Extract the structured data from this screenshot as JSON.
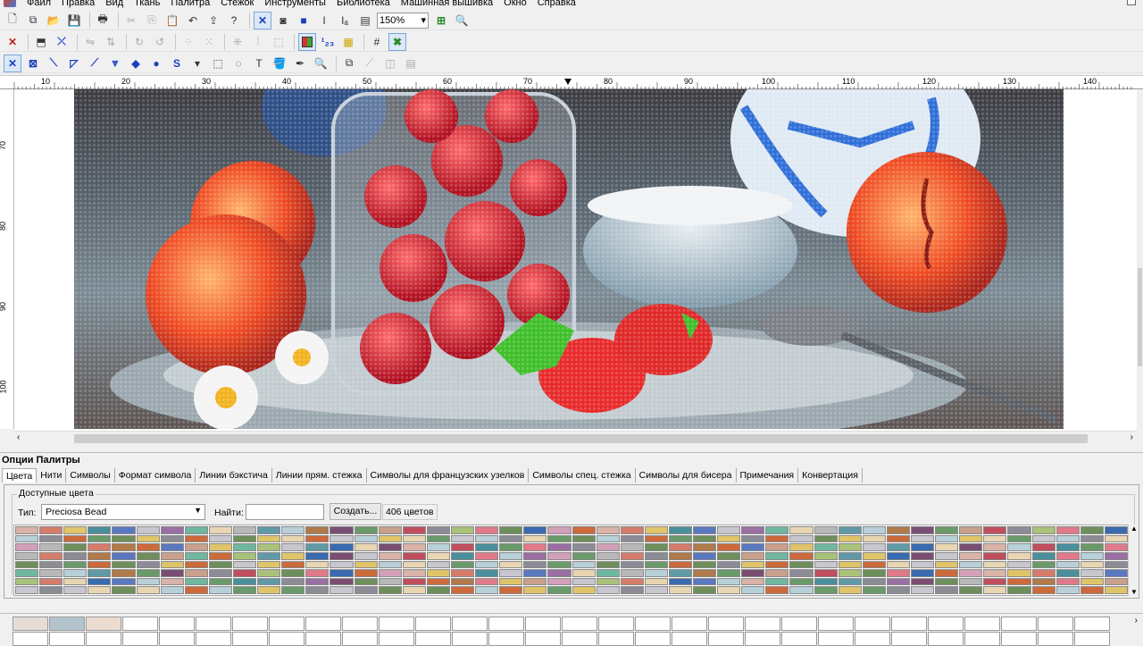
{
  "menu": [
    "Файл",
    "Правка",
    "Вид",
    "Ткань",
    "Палитра",
    "Стежок",
    "Инструменты",
    "Библиотека",
    "Машинная вышивка",
    "Окно",
    "Справка"
  ],
  "toolbar": {
    "zoom_value": "150%",
    "row1_icons": [
      "new-icon",
      "copy-doc-icon",
      "open-icon",
      "save-icon",
      "print-icon",
      "cut-icon",
      "copy-icon",
      "paste-icon",
      "undo-icon",
      "export-icon",
      "help-icon",
      "full-cross-icon",
      "fill-icon",
      "square-icon",
      "text-i-icon",
      "text-ic-icon",
      "doc-icon",
      "zoom-fit-icon",
      "zoom-select-icon"
    ],
    "row2_icons": [
      "delete-icon",
      "move-icon",
      "replace-icon",
      "mirror-h-icon",
      "mirror-v-icon",
      "rotate-cw-icon",
      "rotate-ccw-icon",
      "dots-a-icon",
      "dots-b-icon",
      "dots-c-icon",
      "dots-d-icon",
      "dots-e-icon",
      "palette-icon",
      "number-icon",
      "pattern-icon",
      "grid-icon",
      "cross-grid-icon"
    ],
    "row3_icons": [
      "cross-stitch-icon",
      "half-a-icon",
      "half-b-icon",
      "quarter-a-icon",
      "quarter-b-icon",
      "petite-icon",
      "bead-icon",
      "french-knot-icon",
      "lazy-s-icon",
      "rect-select-icon",
      "lasso-icon",
      "text-icon",
      "fill-bucket-icon",
      "eyedropper-icon",
      "magnify-icon",
      "tool-a-icon",
      "tool-b-icon",
      "tool-c-icon",
      "tool-d-icon"
    ]
  },
  "ruler": {
    "top": [
      "10",
      "20",
      "30",
      "40",
      "50",
      "60",
      "70",
      "80",
      "90",
      "100",
      "110",
      "120",
      "130",
      "140"
    ],
    "left": [
      "70",
      "80",
      "90",
      "100"
    ]
  },
  "palette": {
    "title": "Опции Палитры",
    "tabs": [
      "Цвета",
      "Нити",
      "Символы",
      "Формат символа",
      "Линии бэкстича",
      "Линии прям. стежка",
      "Символы для французских узелков",
      "Символы спец. стежка",
      "Символы для бисера",
      "Примечания",
      "Конвертация"
    ],
    "active_tab": "Цвета",
    "group_label": "Доступные цвета",
    "type_label": "Тип:",
    "type_value": "Preciosa Bead",
    "find_label": "Найти:",
    "find_value": "",
    "create_label": "Создать...",
    "count_label": "406 цветов"
  },
  "colors": {
    "swatch_base": [
      "#d9b2a8",
      "#c8c6ce",
      "#5f9aa6",
      "#c8a08b",
      "#6e8f5b",
      "#d67c6b",
      "#9a6fa3",
      "#b8d0d8",
      "#c04e5f",
      "#3a6bb0",
      "#e0c46a",
      "#6fb7a0",
      "#b07a4a",
      "#8c8c96",
      "#d2a0b8",
      "#4a8f9c",
      "#e8d6b2",
      "#7a4e72",
      "#a9c27a",
      "#cc6a3c",
      "#5a78c0",
      "#b8b8b8",
      "#6a9a6a",
      "#e07a8a"
    ],
    "strip": [
      "#e6dcd6",
      "#b2c3cc",
      "#ecdcd0"
    ]
  }
}
